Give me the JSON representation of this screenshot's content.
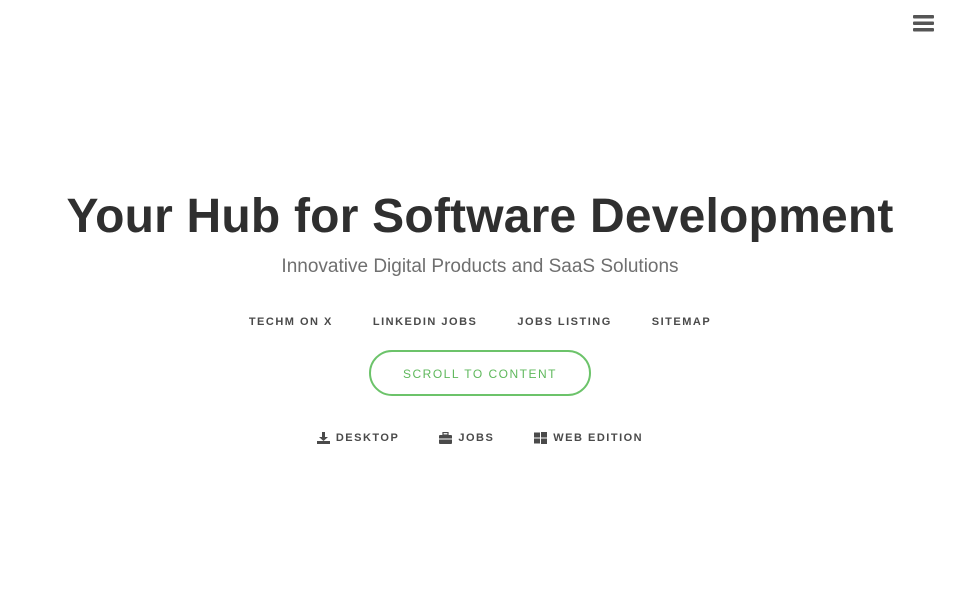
{
  "header": {
    "menu_icon": "hamburger-menu-icon"
  },
  "hero": {
    "title": "Your Hub for Software Development",
    "subtitle": "Innovative Digital Products and SaaS Solutions"
  },
  "links": [
    {
      "label": "TECHM ON X"
    },
    {
      "label": "LINKEDIN JOBS"
    },
    {
      "label": "JOBS LISTING"
    },
    {
      "label": "SITEMAP"
    }
  ],
  "cta": {
    "label": "SCROLL TO CONTENT"
  },
  "downloads": [
    {
      "label": "DESKTOP",
      "icon": "download-icon"
    },
    {
      "label": "JOBS",
      "icon": "briefcase-icon"
    },
    {
      "label": "WEB EDITION",
      "icon": "windows-icon"
    }
  ],
  "colors": {
    "accent": "#6cc36a",
    "title": "#2f2f2f",
    "subtitle": "#6f6f6f",
    "link": "#4a4a4a"
  }
}
